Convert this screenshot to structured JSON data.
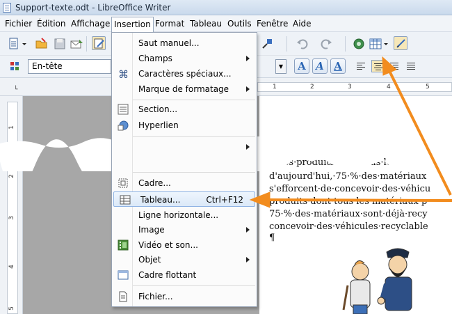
{
  "window": {
    "title": "Support-texte.odt - LibreOffice Writer"
  },
  "menubar": {
    "items": [
      "Fichier",
      "Édition",
      "Affichage",
      "Insertion",
      "Format",
      "Tableau",
      "Outils",
      "Fenêtre",
      "Aide"
    ],
    "active": "Insertion"
  },
  "toolbar": {
    "paragraph_style": "En-tête"
  },
  "ruler": {
    "ticks": [
      "1",
      "2",
      "3",
      "4",
      "5"
    ]
  },
  "vruler": {
    "ticks": [
      "1",
      "2",
      "3",
      "4",
      "5"
    ]
  },
  "insert_menu": {
    "items": [
      {
        "label": "Saut manuel...",
        "icon": "none",
        "submenu": false
      },
      {
        "label": "Champs",
        "icon": "none",
        "submenu": true
      },
      {
        "label": "Caractères spéciaux...",
        "icon": "omega-icon",
        "submenu": false
      },
      {
        "label": "Marque de formatage",
        "icon": "none",
        "submenu": true
      },
      {
        "label": "Section...",
        "icon": "section-icon",
        "submenu": false
      },
      {
        "label": "Hyperlien",
        "icon": "hyperlink-icon",
        "submenu": false
      },
      {
        "label": "Cadre...",
        "icon": "frame-icon",
        "submenu": false
      },
      {
        "label": "Tableau...",
        "icon": "table-icon",
        "shortcut": "Ctrl+F12",
        "submenu": false,
        "highlighted": true
      },
      {
        "label": "Ligne horizontale...",
        "icon": "none",
        "submenu": false
      },
      {
        "label": "Image",
        "icon": "none",
        "submenu": true
      },
      {
        "label": "Vidéo et son...",
        "icon": "video-icon",
        "submenu": false
      },
      {
        "label": "Objet",
        "icon": "none",
        "submenu": true
      },
      {
        "label": "Cadre flottant",
        "icon": "floating-frame-icon",
        "submenu": false
      },
      {
        "label": "Fichier...",
        "icon": "file-icon",
        "submenu": false
      }
    ]
  },
  "document": {
    "lines": [
      "...des·produits·dont·tous·le",
      "d'aujourd'hui,·75·%·des·matériaux",
      "s'efforcent·de·concevoir·des·véhicu",
      "produits·dont·tous·les·matériaux·p",
      "75·%·des·matériaux·sont·déjà·recy",
      "concevoir·des·véhicules·recyclable",
      "¶"
    ]
  },
  "colors": {
    "arrow": "#f28c1e",
    "menu_highlight": "#dbe9f8",
    "gray_area": "#a7a7a7"
  }
}
